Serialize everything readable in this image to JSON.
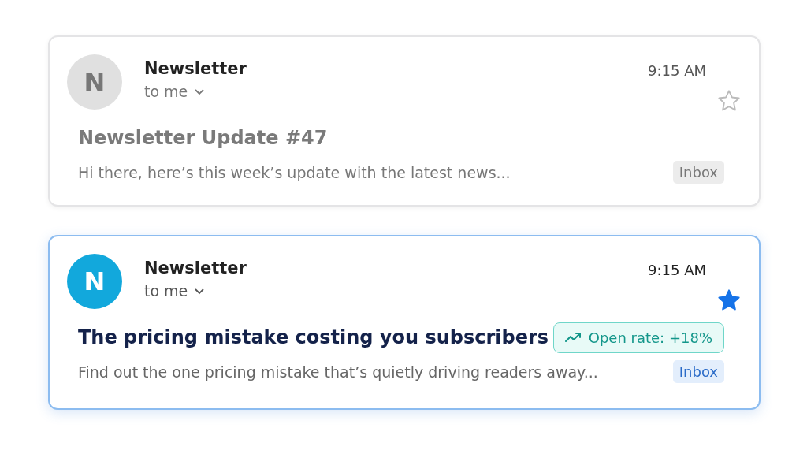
{
  "emails": [
    {
      "highlighted": false,
      "starred": false,
      "avatar": "N",
      "sender": "Newsletter",
      "recipient": "to me",
      "time": "9:15 AM",
      "subject": "Newsletter Update #47",
      "snippet": "Hi there, here’s this week’s update with the latest news...",
      "label": "Inbox"
    },
    {
      "highlighted": true,
      "starred": true,
      "avatar": "N",
      "sender": "Newsletter",
      "recipient": "to me",
      "time": "9:15 AM",
      "subject": "The pricing mistake costing you subscribers",
      "badge": "Open rate: +18%",
      "snippet": "Find out the one pricing mistake that’s quietly driving readers away...",
      "label": "Inbox"
    }
  ]
}
